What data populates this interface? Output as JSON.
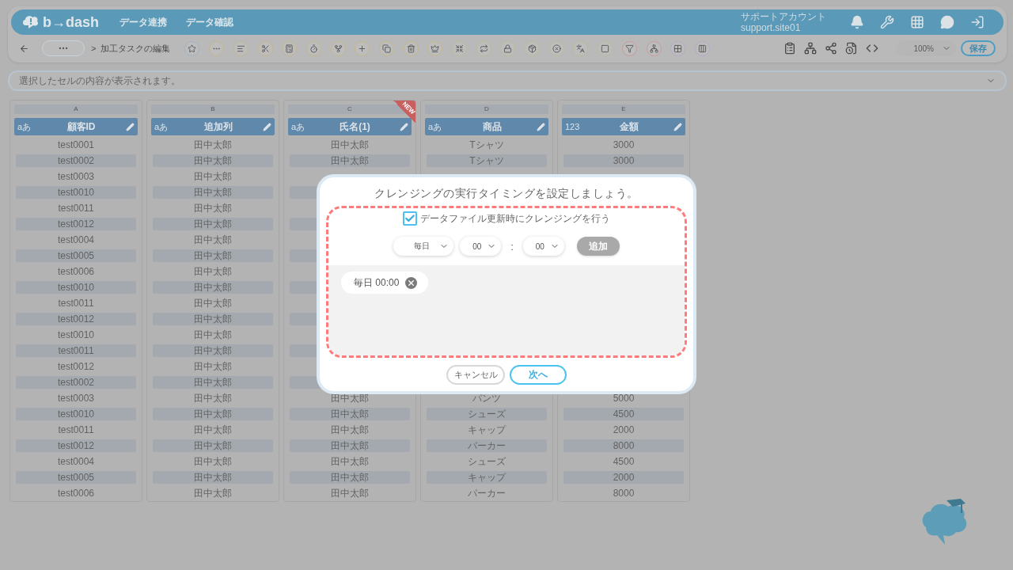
{
  "header": {
    "logo": "b→dash",
    "nav": [
      "データ連携",
      "データ確認"
    ],
    "account_name": "サポートアカウント",
    "account_id": "support.site01"
  },
  "toolbar": {
    "breadcrumb_separator": ">",
    "page_title": "加工タスクの編集",
    "zoom": "100%",
    "save": "保存"
  },
  "formula_bar": {
    "placeholder": "選択したセルの内容が表示されます。"
  },
  "columns": [
    {
      "letter": "A",
      "type_label": "aあ",
      "name": "顧客ID",
      "cells": [
        "test0001",
        "test0002",
        "test0003",
        "test0010",
        "test0011",
        "test0012",
        "test0004",
        "test0005",
        "test0006",
        "test0010",
        "test0011",
        "test0012",
        "test0010",
        "test0011",
        "test0012",
        "test0002",
        "test0003",
        "test0010",
        "test0011",
        "test0012",
        "test0004",
        "test0005",
        "test0006"
      ]
    },
    {
      "letter": "B",
      "type_label": "aあ",
      "name": "追加列",
      "cells": [
        "田中太郎",
        "田中太郎",
        "田中太郎",
        "田中太郎",
        "田中太郎",
        "田中太郎",
        "田中太郎",
        "田中太郎",
        "田中太郎",
        "田中太郎",
        "田中太郎",
        "田中太郎",
        "田中太郎",
        "田中太郎",
        "田中太郎",
        "田中太郎",
        "田中太郎",
        "田中太郎",
        "田中太郎",
        "田中太郎",
        "田中太郎",
        "田中太郎",
        "田中太郎"
      ]
    },
    {
      "letter": "C",
      "type_label": "aあ",
      "name": "氏名(1)",
      "badge": "NEW",
      "cells": [
        "田中太郎",
        "田中太郎",
        null,
        null,
        null,
        null,
        null,
        null,
        null,
        null,
        null,
        null,
        null,
        null,
        null,
        null,
        "田中太郎",
        "田中太郎",
        "田中太郎",
        "田中太郎",
        "田中太郎",
        "田中太郎",
        "田中太郎"
      ]
    },
    {
      "letter": "D",
      "type_label": "aあ",
      "name": "商品",
      "cells": [
        "Tシャツ",
        "Tシャツ",
        null,
        null,
        null,
        null,
        null,
        null,
        null,
        null,
        null,
        null,
        null,
        null,
        null,
        null,
        "パンツ",
        "シューズ",
        "キャップ",
        "パーカー",
        "シューズ",
        "キャップ",
        "パーカー"
      ]
    },
    {
      "letter": "E",
      "type_label": "123",
      "name": "金額",
      "cells": [
        "3000",
        "3000",
        null,
        null,
        null,
        null,
        null,
        null,
        null,
        null,
        null,
        null,
        null,
        null,
        null,
        null,
        "5000",
        "4500",
        "2000",
        "8000",
        "4500",
        "2000",
        "8000"
      ]
    }
  ],
  "dialog": {
    "title": "クレンジングの実行タイミングを設定しましょう。",
    "checkbox": {
      "label": "データファイル更新時にクレンジングを行う",
      "checked": true
    },
    "frequency": "毎日",
    "hour": "00",
    "separator": ":",
    "minute": "00",
    "add_button": {
      "label": "追加",
      "disabled": true
    },
    "schedules": [
      "毎日 00:00"
    ],
    "cancel": "キャンセル",
    "next": "次へ"
  }
}
